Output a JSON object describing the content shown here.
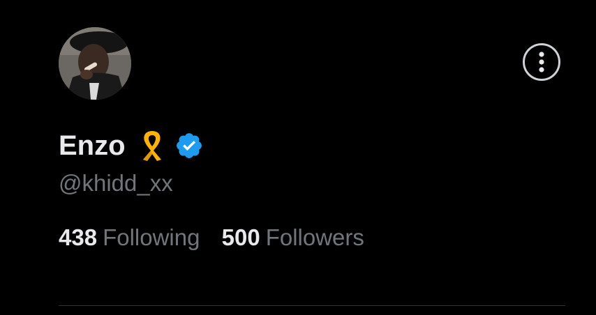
{
  "profile": {
    "display_name": "Enzo",
    "handle": "@khidd_xx",
    "badges": [
      "ribbon-icon",
      "verified-icon"
    ],
    "verified_color": "#1d9bf0",
    "ribbon_color": "#ffb300"
  },
  "stats": {
    "following_count": "438",
    "following_label": "Following",
    "followers_count": "500",
    "followers_label": "Followers"
  },
  "actions": {
    "more_icon": "more-options-icon"
  },
  "colors": {
    "background": "#000000",
    "primary_text": "#e7e9ea",
    "secondary_text": "#71767b",
    "divider": "#2f3336"
  }
}
